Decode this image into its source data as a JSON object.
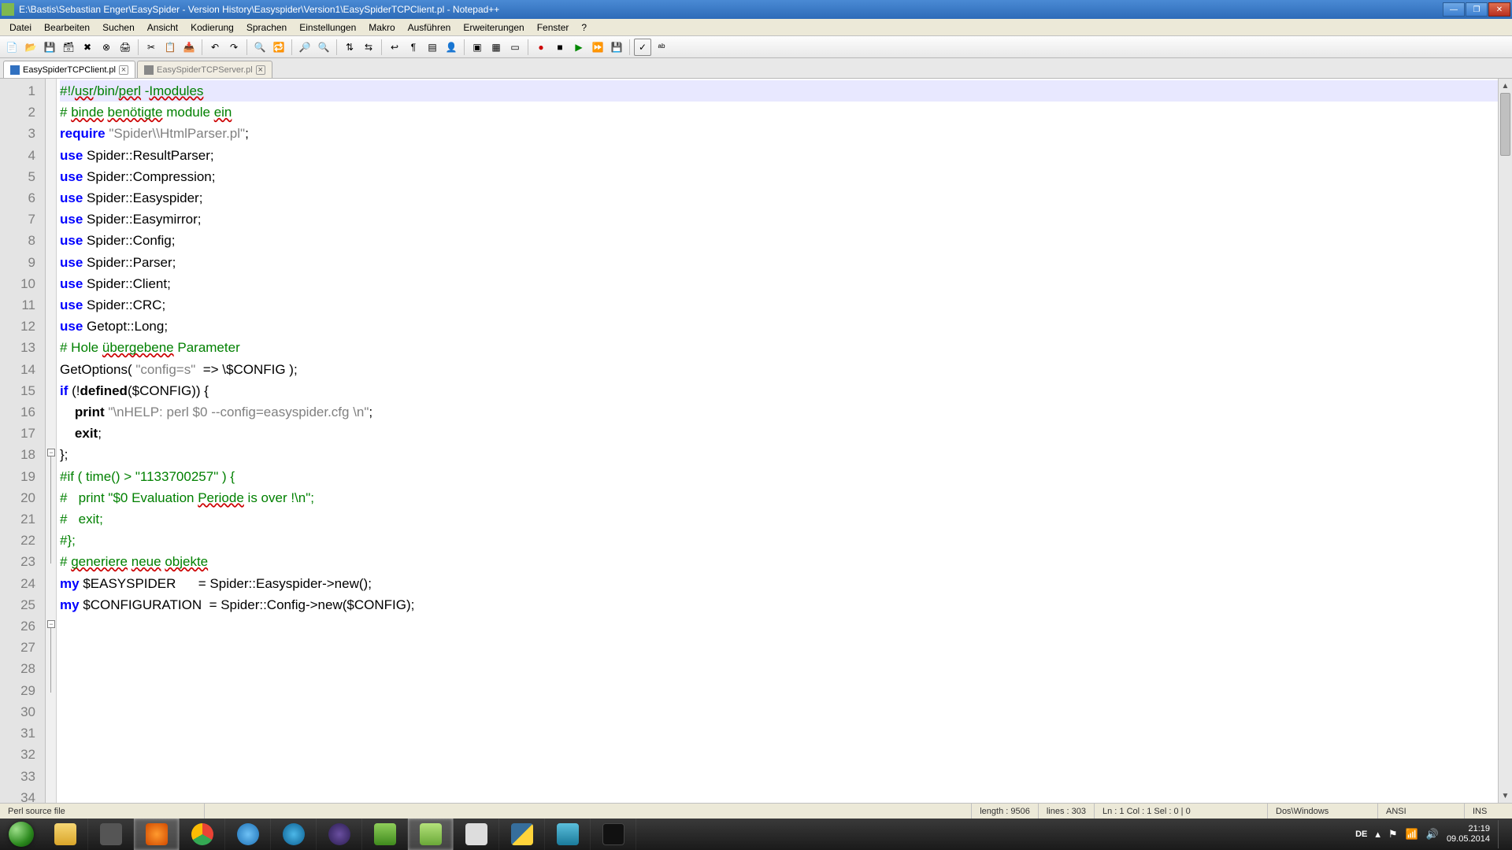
{
  "titlebar": {
    "title": "E:\\Bastis\\Sebastian Enger\\EasySpider - Version History\\Easyspider\\Version1\\EasySpiderTCPClient.pl - Notepad++"
  },
  "menu": [
    "Datei",
    "Bearbeiten",
    "Suchen",
    "Ansicht",
    "Kodierung",
    "Sprachen",
    "Einstellungen",
    "Makro",
    "Ausführen",
    "Erweiterungen",
    "Fenster",
    "?"
  ],
  "tabs": [
    {
      "label": "EasySpiderTCPClient.pl",
      "active": true
    },
    {
      "label": "EasySpiderTCPServer.pl",
      "active": false
    }
  ],
  "code": {
    "lines": [
      {
        "n": 1,
        "hl": true,
        "seg": [
          {
            "t": "#!/",
            "c": "cmt"
          },
          {
            "t": "usr",
            "c": "cmt-u"
          },
          {
            "t": "/bin/",
            "c": "cmt"
          },
          {
            "t": "perl",
            "c": "cmt-u"
          },
          {
            "t": " -",
            "c": "cmt"
          },
          {
            "t": "Imodules",
            "c": "cmt-u"
          }
        ]
      },
      {
        "n": 2,
        "seg": [
          {
            "t": "",
            "c": ""
          }
        ]
      },
      {
        "n": 3,
        "seg": [
          {
            "t": "# ",
            "c": "cmt"
          },
          {
            "t": "binde",
            "c": "cmt-u"
          },
          {
            "t": " ",
            "c": "cmt"
          },
          {
            "t": "benötigte",
            "c": "cmt-u"
          },
          {
            "t": " module ",
            "c": "cmt"
          },
          {
            "t": "ein",
            "c": "cmt-u"
          }
        ]
      },
      {
        "n": 4,
        "seg": [
          {
            "t": "require",
            "c": "kw"
          },
          {
            "t": " ",
            "c": ""
          },
          {
            "t": "\"Spider\\\\HtmlParser.pl\"",
            "c": "str"
          },
          {
            "t": ";",
            "c": ""
          }
        ]
      },
      {
        "n": 5,
        "seg": [
          {
            "t": "use",
            "c": "kw"
          },
          {
            "t": " Spider::ResultParser;",
            "c": ""
          }
        ]
      },
      {
        "n": 6,
        "seg": [
          {
            "t": "use",
            "c": "kw"
          },
          {
            "t": " Spider::Compression;",
            "c": ""
          }
        ]
      },
      {
        "n": 7,
        "seg": [
          {
            "t": "use",
            "c": "kw"
          },
          {
            "t": " Spider::Easyspider;",
            "c": ""
          }
        ]
      },
      {
        "n": 8,
        "seg": [
          {
            "t": "use",
            "c": "kw"
          },
          {
            "t": " Spider::Easymirror;",
            "c": ""
          }
        ]
      },
      {
        "n": 9,
        "seg": [
          {
            "t": "use",
            "c": "kw"
          },
          {
            "t": " Spider::Config;",
            "c": ""
          }
        ]
      },
      {
        "n": 10,
        "seg": [
          {
            "t": "use",
            "c": "kw"
          },
          {
            "t": " Spider::Parser;",
            "c": ""
          }
        ]
      },
      {
        "n": 11,
        "seg": [
          {
            "t": "use",
            "c": "kw"
          },
          {
            "t": " Spider::Client;",
            "c": ""
          }
        ]
      },
      {
        "n": 12,
        "seg": [
          {
            "t": "use",
            "c": "kw"
          },
          {
            "t": " Spider::CRC;",
            "c": ""
          }
        ]
      },
      {
        "n": 13,
        "seg": [
          {
            "t": "use",
            "c": "kw"
          },
          {
            "t": " Getopt::Long;",
            "c": ""
          }
        ]
      },
      {
        "n": 14,
        "seg": [
          {
            "t": "",
            "c": ""
          }
        ]
      },
      {
        "n": 15,
        "seg": [
          {
            "t": "# Hole ",
            "c": "cmt"
          },
          {
            "t": "übergebene",
            "c": "cmt-u"
          },
          {
            "t": " Parameter",
            "c": "cmt"
          }
        ]
      },
      {
        "n": 16,
        "seg": [
          {
            "t": "GetOptions( ",
            "c": ""
          },
          {
            "t": "\"config=s\"",
            "c": "str"
          },
          {
            "t": "  => \\",
            "c": ""
          },
          {
            "t": "$CONFIG",
            "c": "var"
          },
          {
            "t": " );",
            "c": ""
          }
        ]
      },
      {
        "n": 17,
        "seg": [
          {
            "t": "",
            "c": ""
          }
        ]
      },
      {
        "n": 18,
        "seg": [
          {
            "t": "if",
            "c": "kw"
          },
          {
            "t": " (!",
            "c": ""
          },
          {
            "t": "defined",
            "c": "varb"
          },
          {
            "t": "(",
            "c": ""
          },
          {
            "t": "$CONFIG",
            "c": "var"
          },
          {
            "t": ")) {",
            "c": ""
          }
        ]
      },
      {
        "n": 19,
        "seg": [
          {
            "t": "",
            "c": ""
          }
        ]
      },
      {
        "n": 20,
        "seg": [
          {
            "t": "    ",
            "c": ""
          },
          {
            "t": "print",
            "c": "varb"
          },
          {
            "t": " ",
            "c": ""
          },
          {
            "t": "\"\\nHELP: perl $0 --config=easyspider.cfg \\n\"",
            "c": "str"
          },
          {
            "t": ";",
            "c": ""
          }
        ]
      },
      {
        "n": 21,
        "seg": [
          {
            "t": "    ",
            "c": ""
          },
          {
            "t": "exit",
            "c": "varb"
          },
          {
            "t": ";",
            "c": ""
          }
        ]
      },
      {
        "n": 22,
        "seg": [
          {
            "t": "",
            "c": ""
          }
        ]
      },
      {
        "n": 23,
        "seg": [
          {
            "t": "};",
            "c": ""
          }
        ]
      },
      {
        "n": 24,
        "seg": [
          {
            "t": "",
            "c": ""
          }
        ]
      },
      {
        "n": 25,
        "seg": [
          {
            "t": "",
            "c": ""
          }
        ]
      },
      {
        "n": 26,
        "seg": [
          {
            "t": "#if ( time() > \"1133700257\" ) {",
            "c": "cmt"
          }
        ]
      },
      {
        "n": 27,
        "seg": [
          {
            "t": "#   print \"$0 Evaluation ",
            "c": "cmt"
          },
          {
            "t": "Periode",
            "c": "cmt-u"
          },
          {
            "t": " is over !\\n\";",
            "c": "cmt"
          }
        ]
      },
      {
        "n": 28,
        "seg": [
          {
            "t": "#   exit;",
            "c": "cmt"
          }
        ]
      },
      {
        "n": 29,
        "seg": [
          {
            "t": "#};",
            "c": "cmt"
          }
        ]
      },
      {
        "n": 30,
        "seg": [
          {
            "t": "",
            "c": ""
          }
        ]
      },
      {
        "n": 31,
        "seg": [
          {
            "t": "",
            "c": ""
          }
        ]
      },
      {
        "n": 32,
        "seg": [
          {
            "t": "# ",
            "c": "cmt"
          },
          {
            "t": "generiere",
            "c": "cmt-u"
          },
          {
            "t": " ",
            "c": "cmt"
          },
          {
            "t": "neue",
            "c": "cmt-u"
          },
          {
            "t": " ",
            "c": "cmt"
          },
          {
            "t": "objekte",
            "c": "cmt-u"
          }
        ]
      },
      {
        "n": 33,
        "seg": [
          {
            "t": "my",
            "c": "kw"
          },
          {
            "t": " ",
            "c": ""
          },
          {
            "t": "$EASYSPIDER",
            "c": "var"
          },
          {
            "t": "      = Spider::Easyspider->new();",
            "c": ""
          }
        ]
      },
      {
        "n": 34,
        "seg": [
          {
            "t": "my",
            "c": "kw"
          },
          {
            "t": " ",
            "c": ""
          },
          {
            "t": "$CONFIGURATION",
            "c": "var"
          },
          {
            "t": "  = Spider::Config->new(",
            "c": ""
          },
          {
            "t": "$CONFIG",
            "c": "var"
          },
          {
            "t": ");",
            "c": ""
          }
        ]
      }
    ]
  },
  "status": {
    "filetype": "Perl source file",
    "length": "length : 9506",
    "lines": "lines : 303",
    "pos": "Ln : 1    Col : 1    Sel : 0 | 0",
    "eol": "Dos\\Windows",
    "enc": "ANSI",
    "ins": "INS"
  },
  "tray": {
    "lang": "DE",
    "time": "21:19",
    "date": "09.05.2014"
  }
}
